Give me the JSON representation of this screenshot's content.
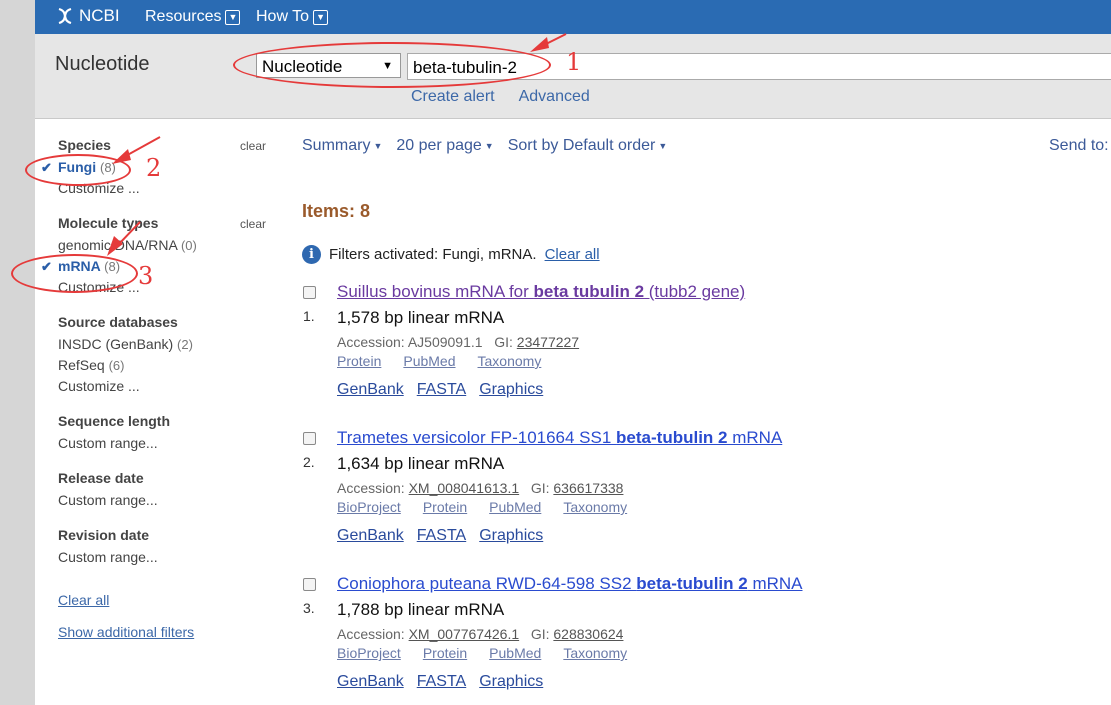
{
  "topbar": {
    "logo": "NCBI",
    "nav": [
      "Resources",
      "How To"
    ]
  },
  "search": {
    "db_title": "Nucleotide",
    "db_select": "Nucleotide",
    "term": "beta-tubulin-2",
    "links": [
      "Create alert",
      "Advanced"
    ]
  },
  "sidebar": {
    "clear_label": "clear",
    "groups": [
      {
        "head": "Species",
        "items": [
          {
            "label": "Fungi",
            "count": "(8)"
          },
          {
            "label": "Customize ..."
          }
        ]
      },
      {
        "head": "Molecule types",
        "items": [
          {
            "label": "genomic DNA/RNA",
            "count": "(0)"
          },
          {
            "label": "mRNA",
            "count": "(8)"
          },
          {
            "label": "Customize ..."
          }
        ]
      },
      {
        "head": "Source databases",
        "items": [
          {
            "label": "INSDC (GenBank)",
            "count": "(2)"
          },
          {
            "label": "RefSeq",
            "count": "(6)"
          },
          {
            "label": "Customize ..."
          }
        ]
      },
      {
        "head": "Sequence length",
        "items": [
          {
            "label": "Custom range..."
          }
        ]
      },
      {
        "head": "Release date",
        "items": [
          {
            "label": "Custom range..."
          }
        ]
      },
      {
        "head": "Revision date",
        "items": [
          {
            "label": "Custom range..."
          }
        ]
      }
    ],
    "clear_all": "Clear all",
    "show_filters": "Show additional filters"
  },
  "display": {
    "summary": "Summary",
    "per_page": "20 per page",
    "sort": "Sort by Default order",
    "send_to": "Send to:"
  },
  "items_label": "Items: 8",
  "filters": {
    "text": "Filters activated: Fungi, mRNA.",
    "clear_all": "Clear all"
  },
  "results": [
    {
      "num": "1.",
      "title_pre": "Suillus bovinus mRNA for ",
      "title_bold": "beta tubulin 2",
      "title_post": " (tubb2 gene)",
      "desc": "1,578 bp linear mRNA",
      "acc_label": "Accession:",
      "acc_value": "AJ509091.1",
      "gi_label": "GI:",
      "gi_value": "23477227",
      "links1": [
        "Protein",
        "PubMed",
        "Taxonomy"
      ],
      "links2": [
        "GenBank",
        "FASTA",
        "Graphics"
      ]
    },
    {
      "num": "2.",
      "title_pre": "Trametes versicolor FP-101664 SS1 ",
      "title_bold": "beta-tubulin 2",
      "title_post": " mRNA",
      "desc": "1,634 bp linear mRNA",
      "acc_label": "Accession:",
      "acc_value": "XM_008041613.1",
      "gi_label": "GI:",
      "gi_value": "636617338",
      "links1": [
        "BioProject",
        "Protein",
        "PubMed",
        "Taxonomy"
      ],
      "links2": [
        "GenBank",
        "FASTA",
        "Graphics"
      ]
    },
    {
      "num": "3.",
      "title_pre": "Coniophora puteana RWD-64-598 SS2 ",
      "title_bold": "beta-tubulin 2",
      "title_post": " mRNA",
      "desc": "1,788 bp linear mRNA",
      "acc_label": "Accession:",
      "acc_value": "XM_007767426.1",
      "gi_label": "GI:",
      "gi_value": "628830624",
      "links1": [
        "BioProject",
        "Protein",
        "PubMed",
        "Taxonomy"
      ],
      "links2": [
        "GenBank",
        "FASTA",
        "Graphics"
      ]
    }
  ],
  "annotations": [
    "1",
    "2",
    "3"
  ],
  "colors": {
    "annotation": "#e53a3a",
    "topbar": "#2a6bb3",
    "link": "#2a4bcf"
  }
}
